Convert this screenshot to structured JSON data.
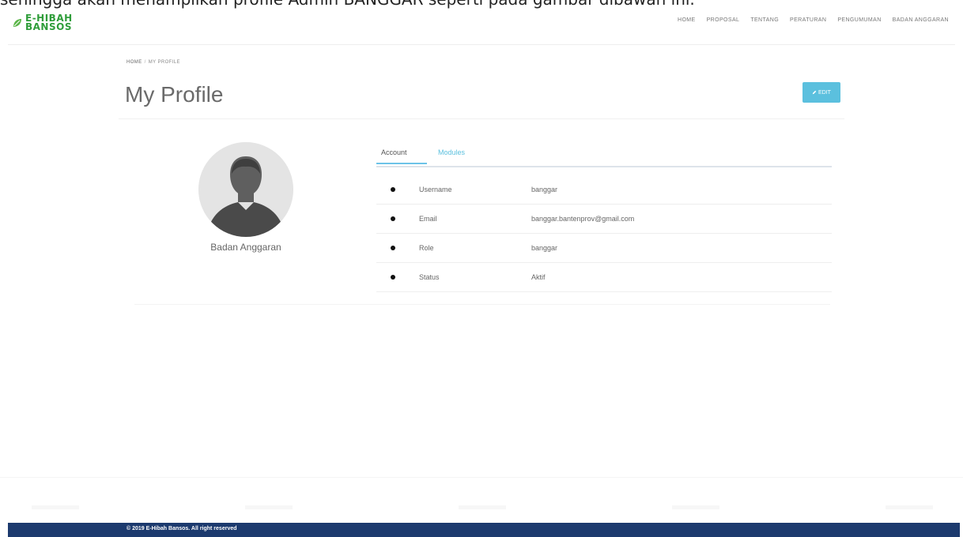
{
  "caption": "sehingga akan menampilkan profile Admin BANGGAR seperti pada gambar dibawah ini.",
  "logo": {
    "line1": "E-HIBAH",
    "line2": "BANSOS"
  },
  "nav": [
    "HOME",
    "PROPOSAL",
    "TENTANG",
    "PERATURAN",
    "PENGUMUMAN",
    "BADAN ANGGARAN"
  ],
  "breadcrumb": {
    "home": "HOME",
    "separator": "/",
    "current": "MY PROFILE"
  },
  "page": {
    "title": "My Profile",
    "edit_label": "EDIT"
  },
  "profile": {
    "name": "Badan Anggaran"
  },
  "tabs": {
    "account": "Account",
    "modules": "Modules"
  },
  "info": [
    {
      "label": "Username",
      "value": "banggar"
    },
    {
      "label": "Email",
      "value": "banggar.bantenprov@gmail.com"
    },
    {
      "label": "Role",
      "value": "banggar"
    },
    {
      "label": "Status",
      "value": "Aktif"
    }
  ],
  "footer": {
    "text": "© 2019 E-Hibah Bansos. All right reserved"
  },
  "colors": {
    "accent": "#5bc0de",
    "footer_bg": "#1c3a6e",
    "logo_green": "#2f9d3a"
  }
}
